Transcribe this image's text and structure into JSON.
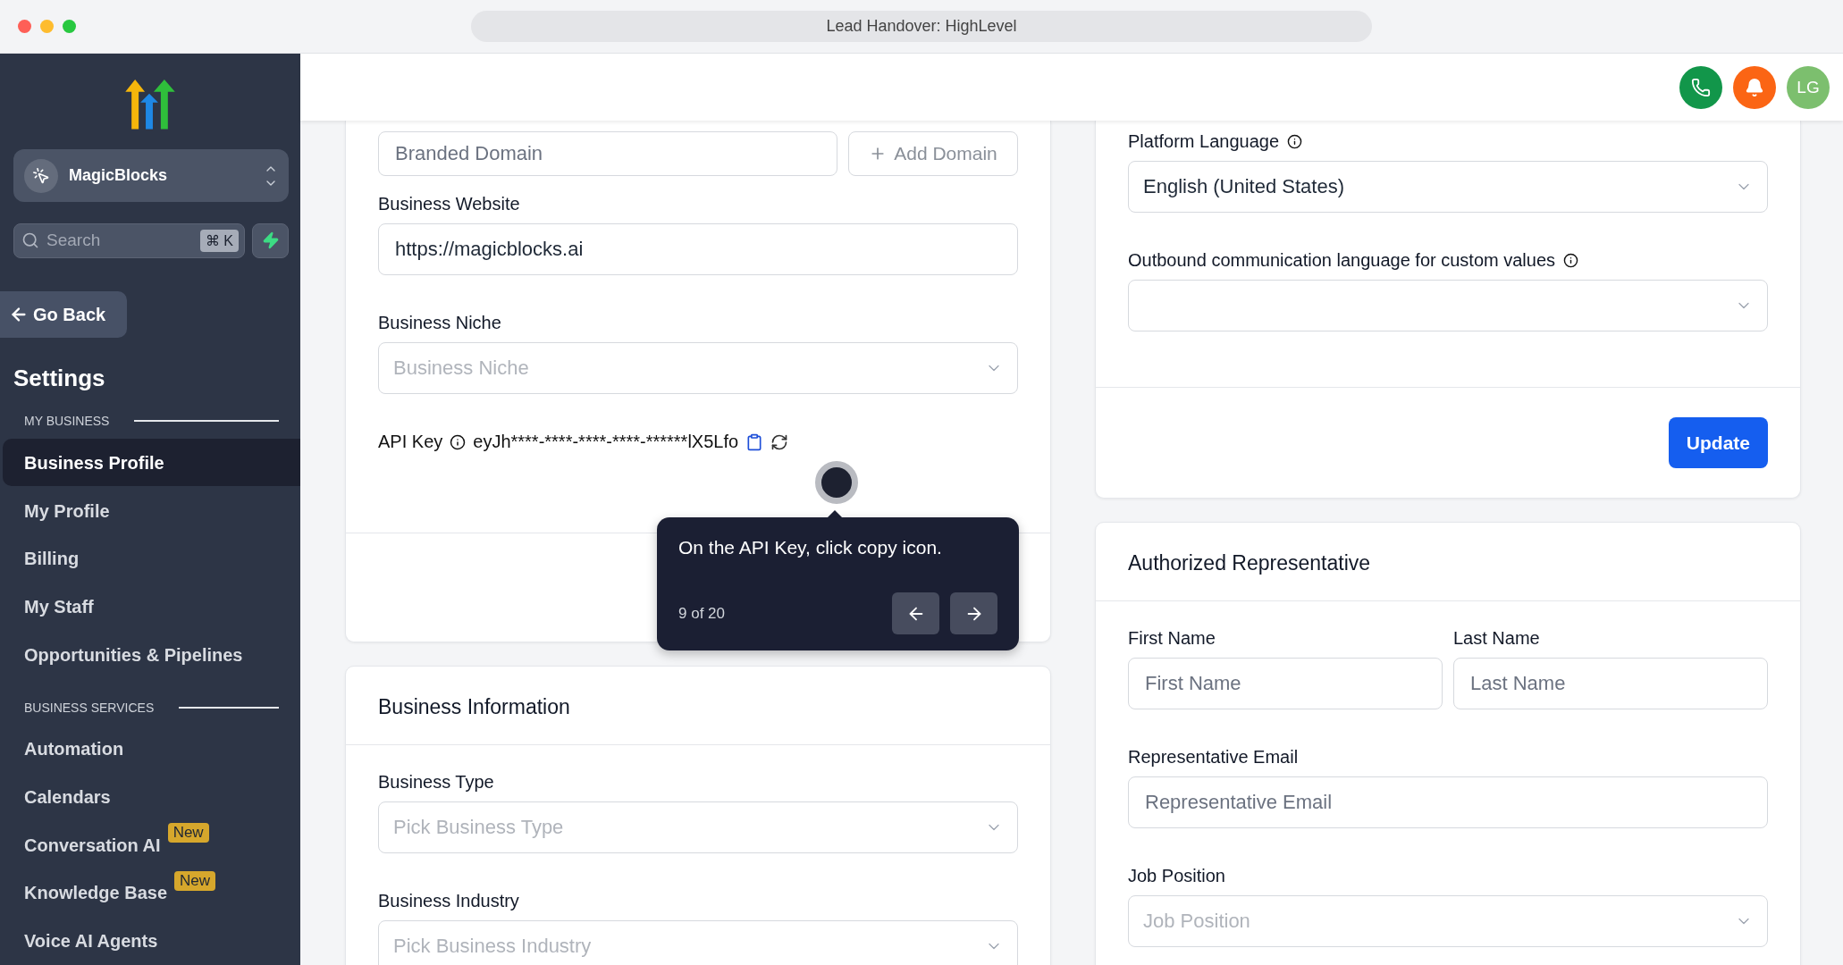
{
  "window": {
    "title": "Lead Handover: HighLevel"
  },
  "sidebar": {
    "account": "MagicBlocks",
    "search": {
      "placeholder": "Search",
      "shortcut": "⌘ K"
    },
    "back": "Go Back",
    "heading": "Settings",
    "sections": [
      {
        "title": "MY BUSINESS",
        "items": [
          {
            "label": "Business Profile",
            "selected": true
          },
          {
            "label": "My Profile",
            "selected": false
          },
          {
            "label": "Billing",
            "selected": false
          },
          {
            "label": "My Staff",
            "selected": false
          },
          {
            "label": "Opportunities & Pipelines",
            "selected": false
          }
        ]
      },
      {
        "title": "BUSINESS SERVICES",
        "items": [
          {
            "label": "Automation",
            "selected": false
          },
          {
            "label": "Calendars",
            "selected": false
          },
          {
            "label": "Conversation AI",
            "badge": "New",
            "selected": false
          },
          {
            "label": "Knowledge Base",
            "badge": "New",
            "selected": false
          },
          {
            "label": "Voice AI Agents",
            "selected": false
          }
        ]
      }
    ]
  },
  "header": {
    "avatar": "LG"
  },
  "business_profile": {
    "branded_domain": {
      "placeholder": "Branded Domain"
    },
    "add_domain": "Add Domain",
    "fields": [
      {
        "label": "Business Website",
        "kind": "input",
        "value": "https://magicblocks.ai"
      },
      {
        "label": "Business Niche",
        "kind": "select",
        "placeholder": "Business Niche"
      }
    ],
    "api_key": {
      "label": "API Key",
      "value": "eyJh****-****-****-****-******lX5Lfo"
    }
  },
  "tour_tooltip": {
    "text": "On the API Key, click copy icon.",
    "step": "9 of 20"
  },
  "business_information": {
    "title": "Business Information",
    "fields": [
      {
        "label": "Business Type",
        "kind": "select",
        "placeholder": "Pick Business Type"
      },
      {
        "label": "Business Industry",
        "kind": "select",
        "placeholder": "Pick Business Industry"
      }
    ]
  },
  "language": {
    "fields": [
      {
        "label": "Platform Language",
        "kind": "select",
        "info": true,
        "value": "English (United States)"
      },
      {
        "label": "Outbound communication language for custom values",
        "kind": "select",
        "info": true
      }
    ],
    "button": "Update"
  },
  "authorized_representative": {
    "title": "Authorized Representative",
    "rows": [
      [
        {
          "label": "First Name",
          "kind": "input",
          "placeholder": "First Name"
        },
        {
          "label": "Last Name",
          "kind": "input",
          "placeholder": "Last Name"
        }
      ],
      [
        {
          "label": "Representative Email",
          "kind": "input",
          "placeholder": "Representative Email"
        }
      ],
      [
        {
          "label": "Job Position",
          "kind": "select",
          "placeholder": "Job Position"
        }
      ]
    ]
  }
}
